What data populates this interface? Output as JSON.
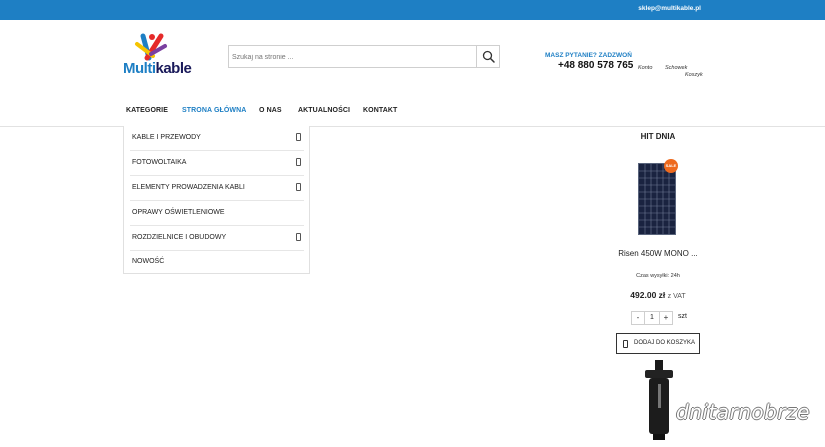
{
  "topbar": {
    "email": "sklep@multikable.pl",
    "color": "#1e7fc4"
  },
  "logo": {
    "part1": "Multi",
    "part2": "kable"
  },
  "search": {
    "placeholder": "Szukaj na stronie ..."
  },
  "contact": {
    "question": "MASZ PYTANIE? ZADZWOŃ",
    "phone": "+48 880 578 765"
  },
  "user_links": {
    "account": "Konto",
    "wishlist": "Schowek",
    "cart": "Koszyk"
  },
  "nav": {
    "categories": "KATEGORIE",
    "home": "STRONA GŁÓWNA",
    "about": "O NAS",
    "news": "AKTUALNOŚCI",
    "contact": "KONTAKT"
  },
  "menu": {
    "items": [
      {
        "label": "KABLE I PRZEWODY",
        "has_submenu": true
      },
      {
        "label": "FOTOWOLTAIKA",
        "has_submenu": true
      },
      {
        "label": "ELEMENTY PROWADZENIA KABLI",
        "has_submenu": true
      },
      {
        "label": "OPRAWY OŚWIETLENIOWE",
        "has_submenu": false
      },
      {
        "label": "ROZDZIELNICE I OBUDOWY",
        "has_submenu": true
      },
      {
        "label": "NOWOŚĆ",
        "has_submenu": false
      }
    ]
  },
  "hit": {
    "title": "HIT DNIA",
    "sale_badge": "SALE",
    "product_name": "Risen 450W MONO ...",
    "shipping": "Czas wysyłki: 24h",
    "price": "492.00 zł",
    "vat": "z VAT",
    "minus": "-",
    "quantity": "1",
    "plus": "+",
    "unit": "szt",
    "add_to_cart": "DODAJ DO KOSZYKA"
  },
  "watermark": "dnitarnobrze"
}
